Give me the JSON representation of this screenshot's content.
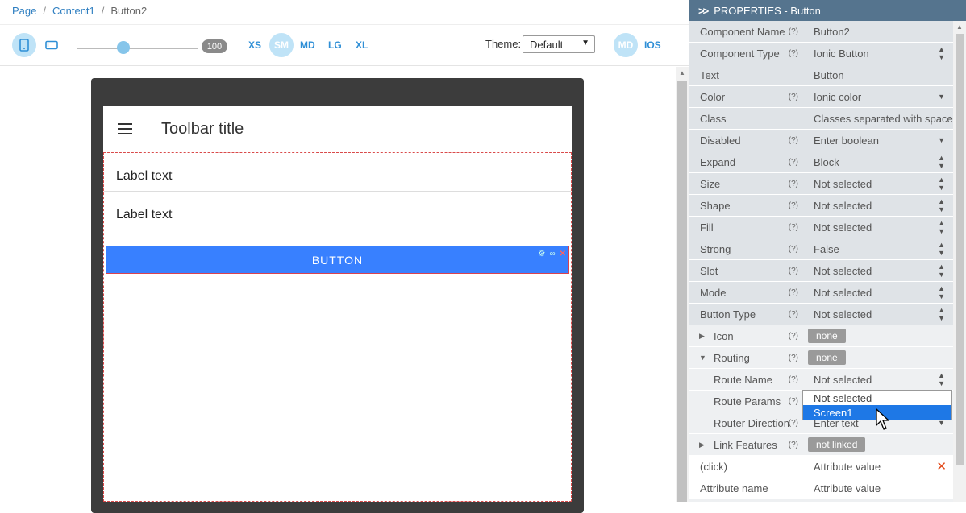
{
  "breadcrumb": {
    "items": [
      "Page",
      "Content1",
      "Button2"
    ]
  },
  "toolbar": {
    "zoom": "100",
    "breakpoints": [
      "XS",
      "SM",
      "MD",
      "LG",
      "XL"
    ],
    "active_breakpoint": "SM",
    "theme_label": "Theme:",
    "theme_value": "Default",
    "modes": [
      "MD",
      "IOS"
    ]
  },
  "preview": {
    "toolbar_title": "Toolbar title",
    "labels": [
      "Label text",
      "Label text"
    ],
    "button_text": "BUTTON"
  },
  "panel": {
    "title": "PROPERTIES - Button",
    "help": "(?)",
    "rows": [
      {
        "name": "Component Name",
        "help": true,
        "value": "Button2",
        "control": "text"
      },
      {
        "name": "Component Type",
        "help": true,
        "value": "Ionic Button",
        "control": "updown"
      },
      {
        "name": "Text",
        "help": false,
        "value": "Button",
        "control": "text"
      },
      {
        "name": "Color",
        "help": true,
        "value": "Ionic color",
        "control": "down"
      },
      {
        "name": "Class",
        "help": false,
        "value": "Classes separated with space",
        "control": "text"
      },
      {
        "name": "Disabled",
        "help": true,
        "value": "Enter boolean",
        "control": "down"
      },
      {
        "name": "Expand",
        "help": true,
        "value": "Block",
        "control": "updown"
      },
      {
        "name": "Size",
        "help": true,
        "value": "Not selected",
        "control": "updown"
      },
      {
        "name": "Shape",
        "help": true,
        "value": "Not selected",
        "control": "updown"
      },
      {
        "name": "Fill",
        "help": true,
        "value": "Not selected",
        "control": "updown"
      },
      {
        "name": "Strong",
        "help": true,
        "value": "False",
        "control": "updown"
      },
      {
        "name": "Slot",
        "help": true,
        "value": "Not selected",
        "control": "updown"
      },
      {
        "name": "Mode",
        "help": true,
        "value": "Not selected",
        "control": "updown"
      },
      {
        "name": "Button Type",
        "help": true,
        "value": "Not selected",
        "control": "updown"
      }
    ],
    "icon_group": {
      "name": "Icon",
      "value": "none"
    },
    "routing_group": {
      "name": "Routing",
      "value": "none"
    },
    "route_name": {
      "name": "Route Name",
      "value": "Not selected"
    },
    "route_params": {
      "name": "Route Params",
      "value": ""
    },
    "router_direction": {
      "name": "Router Direction",
      "value": "Enter text"
    },
    "link_features": {
      "name": "Link Features",
      "value": "not linked"
    },
    "click_attr": {
      "name": "(click)",
      "value": "Attribute value"
    },
    "new_attr": {
      "name": "Attribute name",
      "value": "Attribute value"
    },
    "dropdown_options": [
      "Not selected",
      "Screen1"
    ],
    "dropdown_selected": "Screen1"
  },
  "colors": {
    "accent": "#2f8fd6",
    "header": "#55748e",
    "ion_primary": "#3880ff",
    "selection": "#1e78e6"
  }
}
